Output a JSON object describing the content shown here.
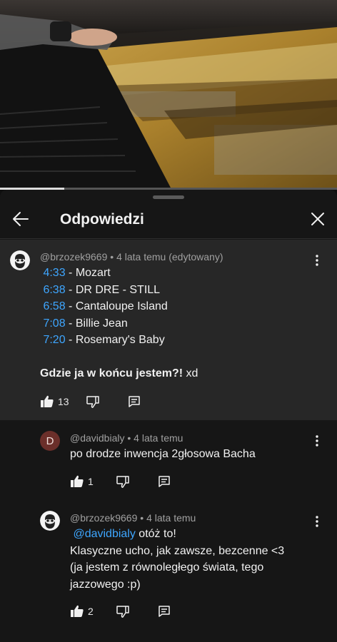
{
  "header": {
    "title": "Odpowiedzi"
  },
  "progress": {
    "fraction": 0.19
  },
  "parent_comment": {
    "author": "@brzozek9669",
    "age": "4 lata temu",
    "edited": "(edytowany)",
    "timestamps": [
      {
        "time": "4:33",
        "label": "- Mozart"
      },
      {
        "time": "6:38",
        "label": "- DR DRE - STILL"
      },
      {
        "time": "6:58",
        "label": "- Cantaloupe Island"
      },
      {
        "time": "7:08",
        "label": "- Billie Jean"
      },
      {
        "time": "7:20",
        "label": "- Rosemary's Baby"
      }
    ],
    "bold_text": "Gdzie ja w końcu jestem?!",
    "trailing_text": " xd",
    "likes": "13"
  },
  "replies": [
    {
      "avatar_letter": "D",
      "author": "@davidbialy",
      "age": "4 lata temu",
      "text": "po drodze inwencja 2głosowa Bacha",
      "likes": "1"
    },
    {
      "author": "@brzozek9669",
      "age": "4 lata temu",
      "mention": "@davidbialy",
      "line1_rest": " otóż to!",
      "line2": "Klasyczne ucho, jak zawsze, bezcenne <3",
      "line3": "(ja jestem z  równoległego świata, tego",
      "line4": "jazzowego :p)",
      "likes": "2"
    }
  ],
  "colors": {
    "link": "#3ea6ff",
    "sheet": "#161616",
    "highlight": "#272727",
    "avatar_d": "#6b2f2a"
  }
}
